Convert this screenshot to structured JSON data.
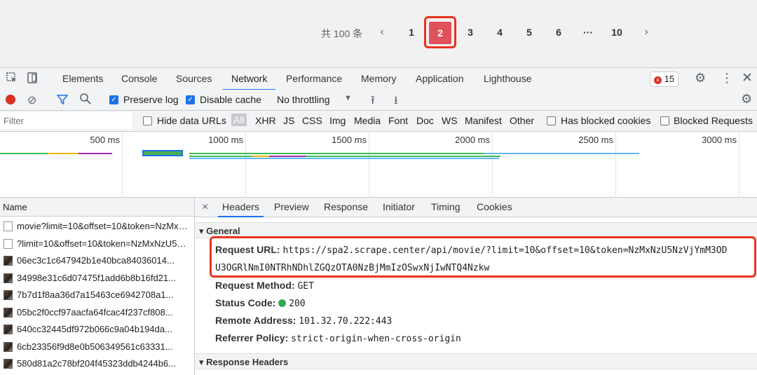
{
  "pagination": {
    "total_label": "共 100 条",
    "prev": "‹",
    "pages": [
      "1",
      "2",
      "3",
      "4",
      "5",
      "6"
    ],
    "ellipsis": "···",
    "last": "10",
    "next": "›",
    "current": "2"
  },
  "devtools": {
    "tabs": [
      "Elements",
      "Console",
      "Sources",
      "Network",
      "Performance",
      "Memory",
      "Application",
      "Lighthouse"
    ],
    "active_tab": "Network",
    "error_count": "15"
  },
  "network_toolbar": {
    "preserve_log": "Preserve log",
    "disable_cache": "Disable cache",
    "throttling": "No throttling"
  },
  "filter_bar": {
    "placeholder": "Filter",
    "hide_data_urls": "Hide data URLs",
    "types": [
      "All",
      "XHR",
      "JS",
      "CSS",
      "Img",
      "Media",
      "Font",
      "Doc",
      "WS",
      "Manifest",
      "Other"
    ],
    "has_blocked_cookies": "Has blocked cookies",
    "blocked_requests": "Blocked Requests"
  },
  "timeline": {
    "ticks": [
      "500 ms",
      "1000 ms",
      "1500 ms",
      "2000 ms",
      "2500 ms",
      "3000 ms"
    ]
  },
  "requests": {
    "header": "Name",
    "rows": [
      {
        "name": "movie?limit=10&offset=10&token=NzMxNz...",
        "icon": "doc"
      },
      {
        "name": "?limit=10&offset=10&token=NzMxNzU5Nz...",
        "icon": "doc"
      },
      {
        "name": "06ec3c1c647942b1e40bca84036014...",
        "icon": "img"
      },
      {
        "name": "34998e31c6d07475f1add6b8b16fd21...",
        "icon": "img"
      },
      {
        "name": "7b7d1f8aa36d7a15463ce6942708a1...",
        "icon": "img"
      },
      {
        "name": "05bc2f0ccf97aacfa64fcac4f237cf808...",
        "icon": "img"
      },
      {
        "name": "640cc32445df972b066c9a04b194da...",
        "icon": "img"
      },
      {
        "name": "6cb23356f9d8e0b506349561c63331...",
        "icon": "img"
      },
      {
        "name": "580d81a2c78bf204f45323ddb4244b6...",
        "icon": "img"
      }
    ]
  },
  "detail": {
    "close": "×",
    "tabs": [
      "Headers",
      "Preview",
      "Response",
      "Initiator",
      "Timing",
      "Cookies"
    ],
    "active_tab": "Headers",
    "general_label": "▾ General",
    "request_url_key": "Request URL:",
    "request_url_line1": "https://spa2.scrape.center/api/movie/?limit=10&offset=10&token=NzMxNzU5NzVjYmM3OD",
    "request_url_line2": "U3OGRlNmI0NTRhNDhlZGQzOTA0NzBjMmIzOSwxNjIwNTQ4Nzkw",
    "method_key": "Request Method:",
    "method_val": "GET",
    "status_key": "Status Code:",
    "status_val": "200",
    "remote_key": "Remote Address:",
    "remote_val": "101.32.70.222:443",
    "referrer_key": "Referrer Policy:",
    "referrer_val": "strict-origin-when-cross-origin",
    "response_headers_label": "▾ Response Headers"
  }
}
